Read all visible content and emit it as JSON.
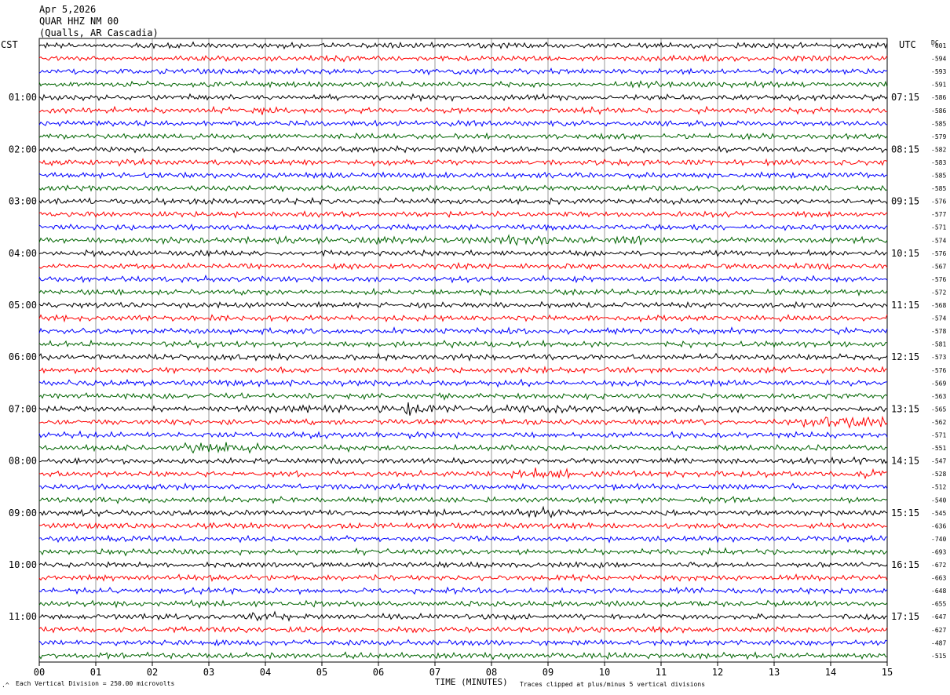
{
  "header": {
    "date": "Apr 5,2026",
    "station": "QUAR HHZ NM 00",
    "location": "(Qualls, AR Cascadia)"
  },
  "left_axis_label": "CST",
  "right_axis_label": "UTC",
  "dc_header": "DC",
  "x_axis_label": "TIME (MINUTES)",
  "footer": {
    "scale": "Each Vertical Division =  250.00 microvolts",
    "clip": "Traces clipped at plus/minus 5 vertical divisions"
  },
  "chart_data": {
    "type": "line",
    "title": "",
    "xlabel": "TIME (MINUTES)",
    "xlim": [
      0,
      15
    ],
    "x_ticks": [
      "00",
      "01",
      "02",
      "03",
      "04",
      "05",
      "06",
      "07",
      "08",
      "09",
      "10",
      "11",
      "12",
      "13",
      "14",
      "15"
    ],
    "rows": 48,
    "minutes_per_row": 15,
    "trace_colors": [
      "#000000",
      "#ff0000",
      "#0000ff",
      "#006400"
    ],
    "left_time_labels": [
      {
        "row": 4,
        "text": "01:00"
      },
      {
        "row": 8,
        "text": "02:00"
      },
      {
        "row": 12,
        "text": "03:00"
      },
      {
        "row": 16,
        "text": "04:00"
      },
      {
        "row": 20,
        "text": "05:00"
      },
      {
        "row": 24,
        "text": "06:00"
      },
      {
        "row": 28,
        "text": "07:00"
      },
      {
        "row": 32,
        "text": "08:00"
      },
      {
        "row": 36,
        "text": "09:00"
      },
      {
        "row": 40,
        "text": "10:00"
      },
      {
        "row": 44,
        "text": "11:00"
      }
    ],
    "right_time_labels": [
      {
        "row": 4,
        "text": "07:15"
      },
      {
        "row": 8,
        "text": "08:15"
      },
      {
        "row": 12,
        "text": "09:15"
      },
      {
        "row": 16,
        "text": "10:15"
      },
      {
        "row": 20,
        "text": "11:15"
      },
      {
        "row": 24,
        "text": "12:15"
      },
      {
        "row": 28,
        "text": "13:15"
      },
      {
        "row": 32,
        "text": "14:15"
      },
      {
        "row": 36,
        "text": "15:15"
      },
      {
        "row": 40,
        "text": "16:15"
      },
      {
        "row": 44,
        "text": "17:15"
      }
    ],
    "dc_offsets": [
      "-601",
      "-594",
      "-593",
      "-591",
      "-586",
      "-586",
      "-585",
      "-579",
      "-582",
      "-583",
      "-585",
      "-585",
      "-576",
      "-577",
      "-571",
      "-574",
      "-576",
      "-567",
      "-576",
      "-572",
      "-568",
      "-574",
      "-578",
      "-581",
      "-573",
      "-576",
      "-569",
      "-563",
      "-565",
      "-562",
      "-571",
      "-551",
      "-547",
      "-528",
      "-512",
      "-540",
      "-545",
      "-636",
      "-740",
      "-693",
      "-672",
      "-663",
      "-648",
      "-655",
      "-647",
      "-627",
      "-487",
      "-515"
    ],
    "events": [
      {
        "row": 5,
        "start_min": 3.8,
        "end_min": 4.3,
        "amplitude": 1.8
      },
      {
        "row": 9,
        "start_min": 1.3,
        "end_min": 2.0,
        "amplitude": 1.3
      },
      {
        "row": 15,
        "start_min": 2.0,
        "end_min": 11.5,
        "amplitude": 1.3
      },
      {
        "row": 15,
        "start_min": 8.2,
        "end_min": 9.0,
        "amplitude": 2.0
      },
      {
        "row": 15,
        "start_min": 10.5,
        "end_min": 11.0,
        "amplitude": 1.8
      },
      {
        "row": 27,
        "start_min": 7.1,
        "end_min": 7.2,
        "amplitude": 3.5
      },
      {
        "row": 28,
        "start_min": 3.0,
        "end_min": 12.5,
        "amplitude": 1.5
      },
      {
        "row": 28,
        "start_min": 6.3,
        "end_min": 6.7,
        "amplitude": 2.5
      },
      {
        "row": 29,
        "start_min": 13.5,
        "end_min": 15.0,
        "amplitude": 2.5
      },
      {
        "row": 31,
        "start_min": 2.3,
        "end_min": 4.0,
        "amplitude": 2.0
      },
      {
        "row": 32,
        "start_min": 14.0,
        "end_min": 15.0,
        "amplitude": 1.8
      },
      {
        "row": 33,
        "start_min": 8.3,
        "end_min": 9.5,
        "amplitude": 2.2
      },
      {
        "row": 33,
        "start_min": 14.5,
        "end_min": 15.0,
        "amplitude": 2.0
      },
      {
        "row": 36,
        "start_min": 8.3,
        "end_min": 9.2,
        "amplitude": 1.8
      },
      {
        "row": 44,
        "start_min": 3.5,
        "end_min": 4.5,
        "amplitude": 2.0
      }
    ]
  }
}
